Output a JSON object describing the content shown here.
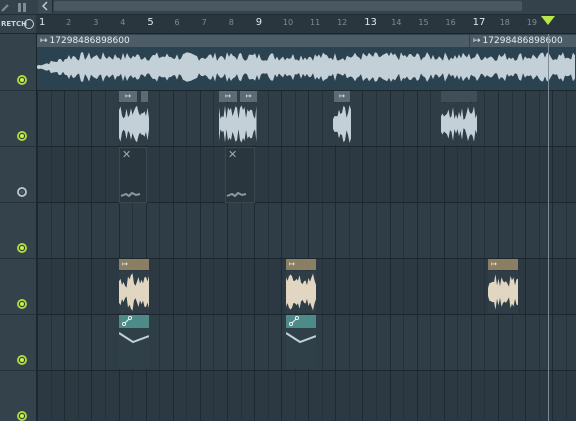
{
  "toolbar": {
    "scroll_left_icon": "chevron-left-icon"
  },
  "ruler": {
    "stretch_label": "RETCH",
    "bars": [
      "1",
      "2",
      "3",
      "4",
      "5",
      "6",
      "7",
      "8",
      "9",
      "10",
      "11",
      "12",
      "13",
      "14",
      "15",
      "16",
      "17",
      "18",
      "19"
    ],
    "major_bars": [
      "1",
      "5",
      "9",
      "13",
      "17"
    ]
  },
  "tracks": [
    {
      "led": "on"
    },
    {
      "led": "on"
    },
    {
      "led": "off"
    },
    {
      "led": "on"
    },
    {
      "led": "on"
    },
    {
      "led": "on"
    },
    {
      "led": "on"
    }
  ],
  "clips": {
    "audio_clip_1_label": "17298486898600",
    "audio_clip_2_label": "17298486898600"
  },
  "colors": {
    "accent_green": "#a8d83a",
    "playhead": "#b9e64a",
    "waveform": "#c4d0d8",
    "clip_tan": "#8a7f62",
    "clip_teal": "#4c8b88"
  }
}
